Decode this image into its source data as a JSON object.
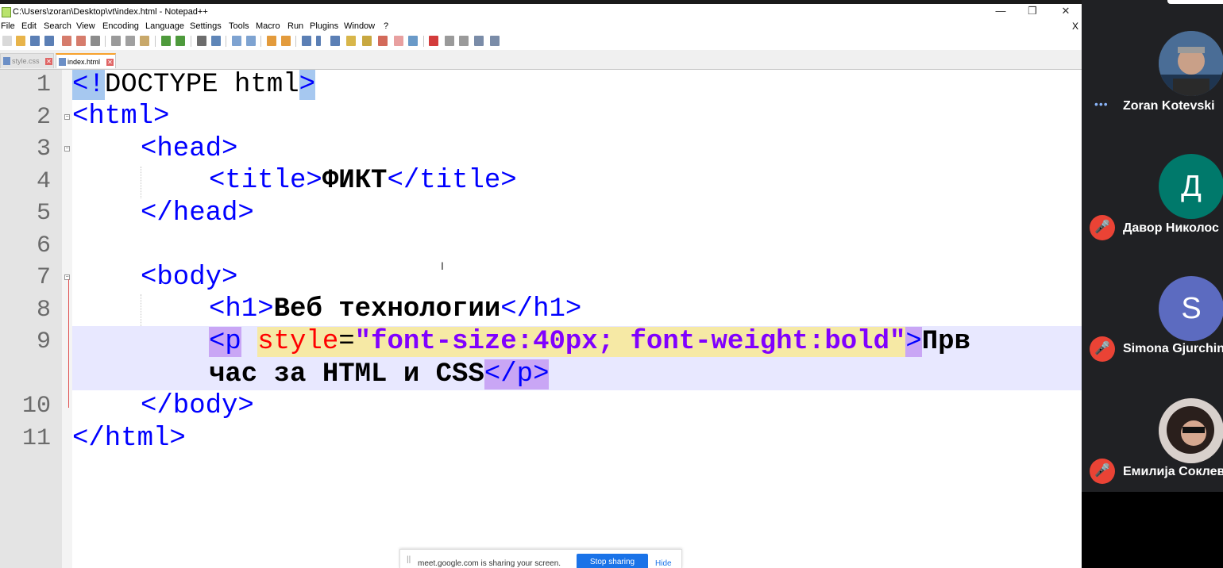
{
  "window": {
    "title": "C:\\Users\\zoran\\Desktop\\vt\\index.html - Notepad++",
    "minimize": "—",
    "maximize": "❐",
    "close": "✕"
  },
  "menu": {
    "items": [
      "File",
      "Edit",
      "Search",
      "View",
      "Encoding",
      "Language",
      "Settings",
      "Tools",
      "Macro",
      "Run",
      "Plugins",
      "Window",
      "?"
    ],
    "close_doc": "X"
  },
  "tabs": [
    {
      "label": "style.css",
      "active": false
    },
    {
      "label": "index.html",
      "active": true
    }
  ],
  "editor": {
    "line_numbers": [
      "1",
      "2",
      "3",
      "4",
      "5",
      "6",
      "7",
      "8",
      "9",
      "10",
      "11"
    ],
    "lines": {
      "l1": {
        "lt": "<!",
        "doctype": "DOCTYPE html",
        "gt": ">"
      },
      "l2": {
        "tag": "<html>"
      },
      "l3": {
        "tag": "<head>"
      },
      "l4": {
        "open": "<title>",
        "text": "ФИКТ",
        "close": "</title>"
      },
      "l5": {
        "tag": "</head>"
      },
      "l7": {
        "tag": "<body>"
      },
      "l8": {
        "open": "<h1>",
        "text": "Веб технологии",
        "close": "</h1>"
      },
      "l9": {
        "open_p": "<p",
        "attr": "style",
        "eq": "=",
        "value": "\"font-size:40px; font-weight:bold\"",
        "gt": ">",
        "text_a": "Прв"
      },
      "l9b": {
        "text_b": "час за HTML и CSS",
        "close_p": "</p>"
      },
      "l10": {
        "tag": "</body>"
      },
      "l11": {
        "tag": "</html>"
      }
    },
    "cursor": "I"
  },
  "share_banner": {
    "text": "meet.google.com is sharing your screen.",
    "stop": "Stop sharing",
    "hide": "Hide"
  },
  "participants": [
    {
      "name": "Zoran Kotevski",
      "initial": "",
      "muted": false,
      "speaking": "•••",
      "color": "#3f5f86"
    },
    {
      "name": "Давор Николос",
      "initial": "Д",
      "muted": true,
      "color": "#00796b"
    },
    {
      "name": "Simona Gjurchin",
      "initial": "S",
      "muted": true,
      "color": "#5c6bc0"
    },
    {
      "name": "Емилија Соклев",
      "initial": "",
      "muted": true,
      "color": "#5a4a44"
    }
  ],
  "mic_off_icon": "mic-off-icon"
}
